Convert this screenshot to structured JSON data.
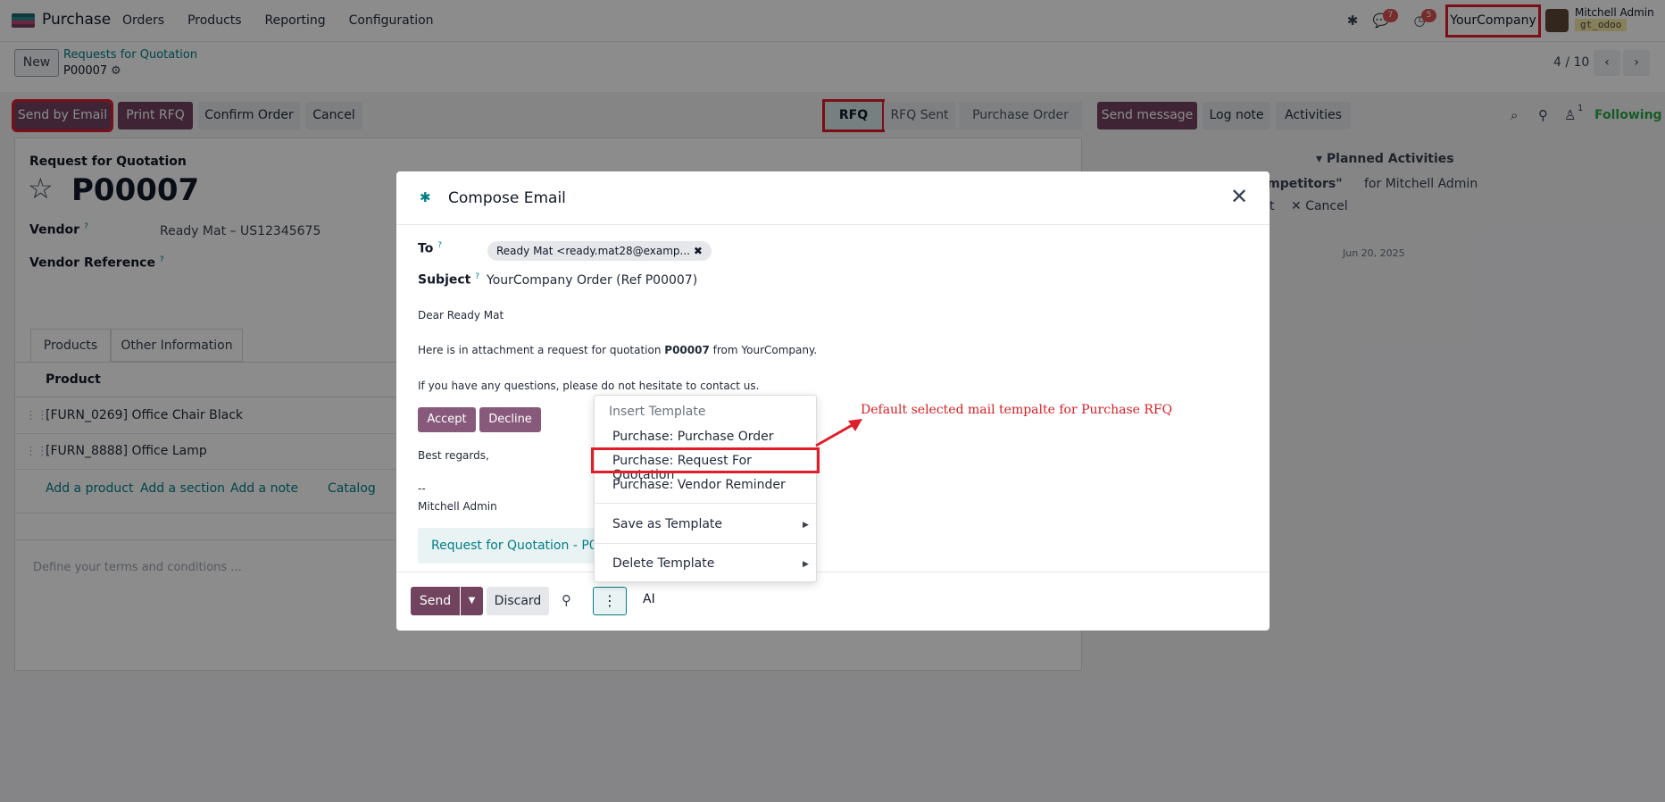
{
  "nav": {
    "app_name": "Purchase",
    "menu": [
      "Orders",
      "Products",
      "Reporting",
      "Configuration"
    ],
    "chat_badge": "7",
    "activity_badge": "5",
    "company": "YourCompany",
    "user_name": "Mitchell Admin",
    "db_name": "gt_odoo"
  },
  "control": {
    "new_label": "New",
    "breadcrumb_parent": "Requests for Quotation",
    "breadcrumb_current": "P00007",
    "pager": "4 / 10"
  },
  "actions": {
    "send_by_email": "Send by Email",
    "print_rfq": "Print RFQ",
    "confirm_order": "Confirm Order",
    "cancel": "Cancel"
  },
  "statusbar": [
    "RFQ",
    "RFQ Sent",
    "Purchase Order"
  ],
  "form": {
    "title_small": "Request for Quotation",
    "title": "P00007",
    "vendor_label": "Vendor",
    "vendor_value": "Ready Mat – US12345675",
    "vendor_ref_label": "Vendor Reference",
    "help_mark": "?",
    "tabs": [
      "Products",
      "Other Information"
    ],
    "column_product": "Product",
    "lines": [
      "[FURN_0269] Office Chair Black",
      "[FURN_8888] Office Lamp"
    ],
    "add_links": [
      "Add a product",
      "Add a section",
      "Add a note",
      "Catalog"
    ],
    "terms_placeholder": "Define your terms and conditions ..."
  },
  "chatter": {
    "send_message": "Send message",
    "log_note": "Log note",
    "activities": "Activities",
    "followers_count": "1",
    "following": "Following",
    "planned_activities": "Planned Activities",
    "activity_fragment": "s competitors\"",
    "activity_for": "for Mitchell Admin",
    "edit_fragment": "t",
    "cancel_link": "Cancel",
    "date": "Jun 20, 2025"
  },
  "modal": {
    "title": "Compose Email",
    "to_label": "To",
    "to_tag": "Ready Mat <ready.mat28@examp...",
    "subject_label": "Subject",
    "subject_value": "YourCompany Order (Ref P00007)",
    "greeting": "Dear Ready Mat",
    "line1_pre": "Here is in attachment a request for quotation ",
    "line1_bold": "P00007",
    "line1_post": " from YourCompany.",
    "line2": "If you have any questions, please do not hesitate to contact us.",
    "accept": "Accept",
    "decline": "Decline",
    "regards": "Best regards,",
    "signature_sep": "--",
    "signature": "Mitchell Admin",
    "attachment": "Request for Quotation - P00",
    "send": "Send",
    "discard": "Discard",
    "ai": "AI"
  },
  "dropdown": {
    "header": "Insert Template",
    "templates": [
      "Purchase: Purchase Order",
      "Purchase: Request For Quotation",
      "Purchase: Vendor Reminder"
    ],
    "save_as": "Save as Template",
    "delete": "Delete Template"
  },
  "annotation": "Default selected mail tempalte for Purchase RFQ",
  "colors": {
    "brand_primary": "#71435f",
    "accent_teal": "#017e84",
    "highlight_red": "#e11d2a",
    "following_green": "#28a745"
  }
}
